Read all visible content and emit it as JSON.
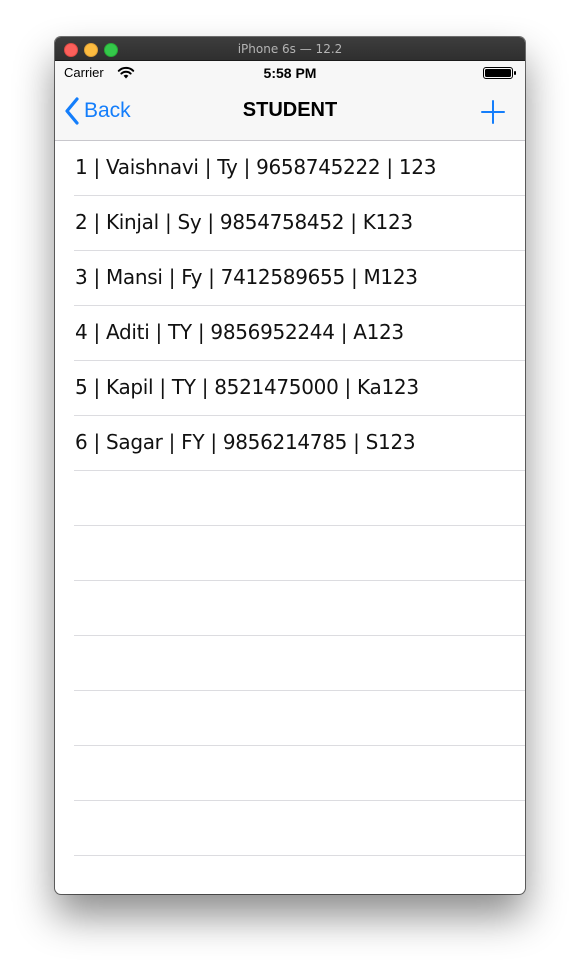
{
  "window": {
    "title": "iPhone 6s — 12.2"
  },
  "status_bar": {
    "carrier": "Carrier",
    "time": "5:58 PM"
  },
  "nav_bar": {
    "back_label": "Back",
    "title": "STUDENT",
    "add_icon": "plus-icon"
  },
  "students": [
    "1 | Vaishnavi | Ty | 9658745222 | 123",
    "2 | Kinjal | Sy | 9854758452 | K123",
    "3 | Mansi | Fy | 7412589655 | M123",
    "4 | Aditi | TY | 9856952244 | A123",
    "5 | Kapil | TY | 8521475000 | Ka123",
    "6 | Sagar | FY | 9856214785 | S123"
  ],
  "colors": {
    "accent": "#147efb",
    "bar_background": "#f7f7f7",
    "separator": "#dcdce0"
  }
}
